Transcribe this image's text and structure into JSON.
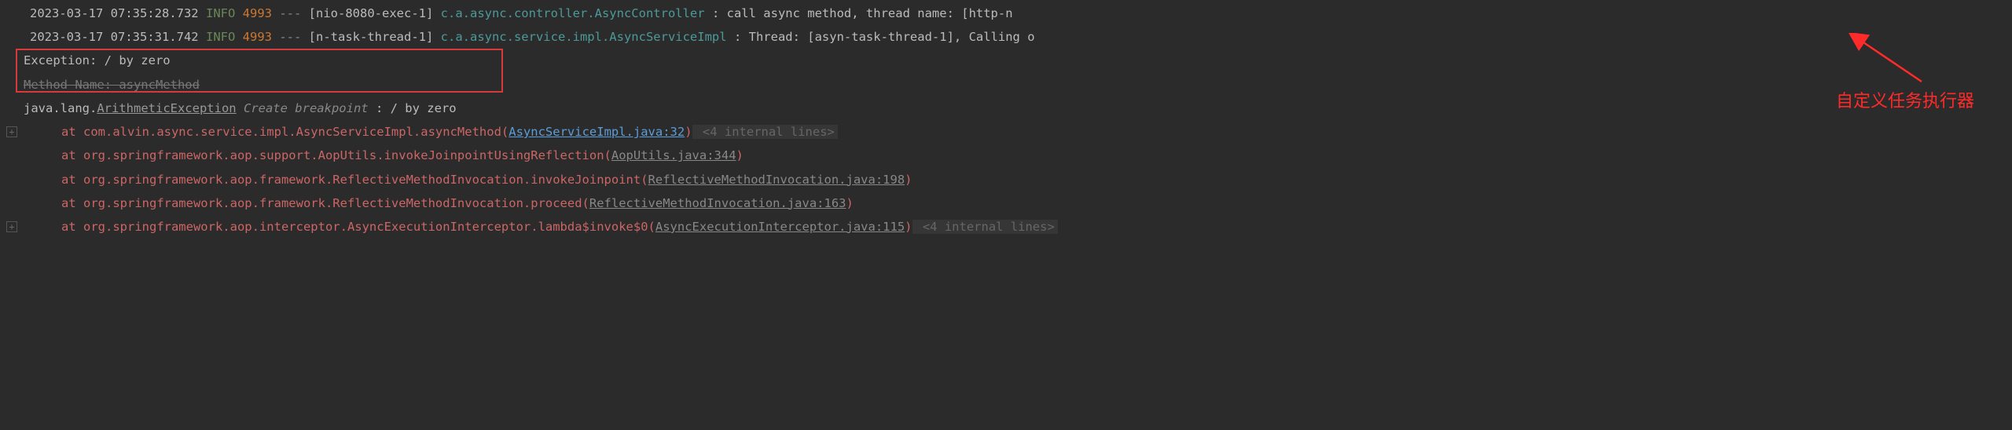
{
  "logs": [
    {
      "timestamp": "2023-03-17 07:35:28.732",
      "level": "INFO",
      "pid": "4993",
      "dashes": "---",
      "thread": "[nio-8080-exec-1]",
      "logger": "c.a.async.controller.AsyncController",
      "msg": ": call async method, thread name: [http-n"
    },
    {
      "timestamp": "2023-03-17 07:35:31.742",
      "level": "INFO",
      "pid": "4993",
      "dashes": "---",
      "thread": "[n-task-thread-1]",
      "logger": "c.a.async.service.impl.AsyncServiceImpl",
      "msg": ": Thread: [asyn-task-thread-1], Calling o"
    }
  ],
  "exception_line": "Exception: / by zero",
  "method_name_line": "Method Name: asyncMethod",
  "exc_header": {
    "pkg": "java.lang.",
    "cls": "ArithmeticException",
    "bp": "Create breakpoint",
    "rest": " : / by zero"
  },
  "stack": [
    {
      "prefix": "at com.alvin.async.service.impl.AsyncServiceImpl.asyncMethod(",
      "link": "AsyncServiceImpl.java:32",
      "link_class": "blue-link",
      "suffix": ")",
      "internal": " <4 internal lines>",
      "has_expand": true
    },
    {
      "prefix": "at org.springframework.aop.support.AopUtils.invokeJoinpointUsingReflection(",
      "link": "AopUtils.java:344",
      "link_class": "gray-link",
      "suffix": ")",
      "internal": "",
      "has_expand": false
    },
    {
      "prefix": "at org.springframework.aop.framework.ReflectiveMethodInvocation.invokeJoinpoint(",
      "link": "ReflectiveMethodInvocation.java:198",
      "link_class": "gray-link",
      "suffix": ")",
      "internal": "",
      "has_expand": false
    },
    {
      "prefix": "at org.springframework.aop.framework.ReflectiveMethodInvocation.proceed(",
      "link": "ReflectiveMethodInvocation.java:163",
      "link_class": "gray-link",
      "suffix": ")",
      "internal": "",
      "has_expand": false
    },
    {
      "prefix": "at org.springframework.aop.interceptor.AsyncExecutionInterceptor.lambda$invoke$0(",
      "link": "AsyncExecutionInterceptor.java:115",
      "link_class": "gray-link",
      "suffix": ")",
      "internal": " <4 internal lines>",
      "has_expand": true
    }
  ],
  "annotation_text": "自定义任务执行器"
}
